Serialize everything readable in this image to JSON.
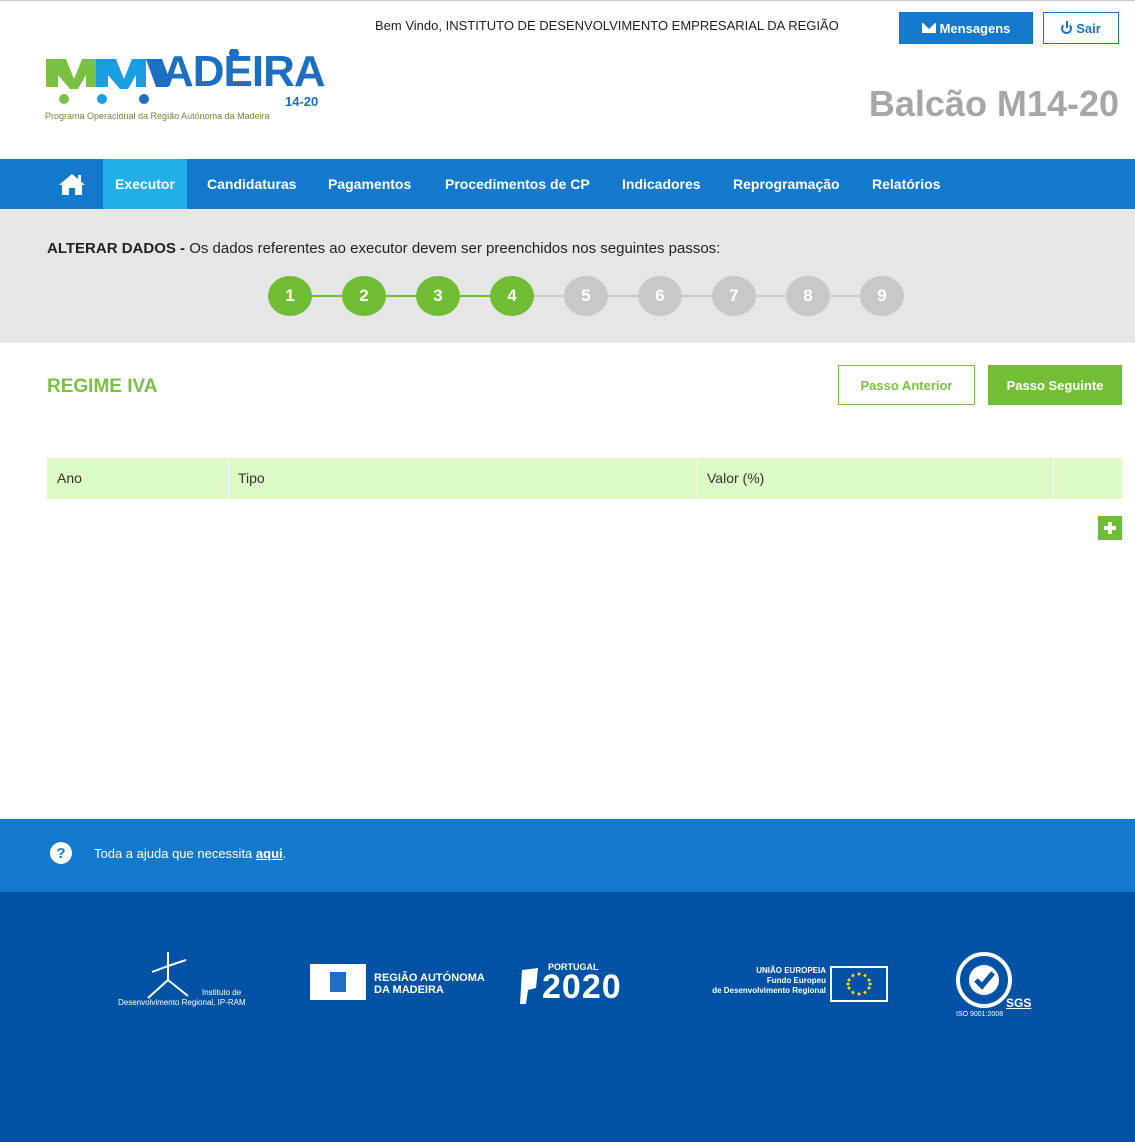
{
  "header": {
    "welcome": "Bem Vindo, INSTITUTO DE DESENVOLVIMENTO EMPRESARIAL DA REGIÃO",
    "messages_label": "Mensagens",
    "logout_label": "Sair",
    "logo_word": "ADEIRA",
    "logo_number": "14-20",
    "logo_subtitle": "Programa Operacional da Região Autónoma da Madeira",
    "portal_title": "Balcão M14-20"
  },
  "nav": {
    "items": [
      {
        "label": "Executor"
      },
      {
        "label": "Candidaturas"
      },
      {
        "label": "Pagamentos"
      },
      {
        "label": "Procedimentos de CP"
      },
      {
        "label": "Indicadores"
      },
      {
        "label": "Reprogramação"
      },
      {
        "label": "Relatórios"
      }
    ],
    "active_index": 0
  },
  "steps": {
    "title_bold": "ALTERAR DADOS -",
    "title_rest": " Os dados referentes ao executor devem ser preenchidos nos seguintes passos:",
    "items": [
      "1",
      "2",
      "3",
      "4",
      "5",
      "6",
      "7",
      "8",
      "9"
    ],
    "completed_count": 4
  },
  "section": {
    "title": "REGIME IVA",
    "prev_label": "Passo Anterior",
    "next_label": "Passo Seguinte"
  },
  "table": {
    "columns": [
      "Ano",
      "Tipo",
      "Valor (%)"
    ],
    "rows": []
  },
  "help": {
    "text": "Toda a ajuda que necessita ",
    "link": "aqui",
    "suffix": "."
  },
  "footer": {
    "logos": [
      {
        "name": "Instituto de Desenvolvimento Regional, IP-RAM",
        "line1": "Instituto de",
        "line2": "Desenvolvimento Regional, IP-RAM"
      },
      {
        "name": "Região Autónoma da Madeira",
        "line1": "REGIÃO AUTÓNOMA",
        "line2": "DA MADEIRA"
      },
      {
        "name": "Portugal 2020",
        "line1": "PORTUGAL",
        "line2": "2020"
      },
      {
        "name": "União Europeia",
        "line1": "UNIÃO EUROPEIA",
        "line2": "Fundo Europeu",
        "line3": "de Desenvolvimento Regional"
      },
      {
        "name": "SGS ISO 9001:2008",
        "line1": "SGS",
        "line2": "ISO 9001:2008"
      }
    ]
  },
  "colors": {
    "primary_blue": "#1279cc",
    "active_nav": "#22aee8",
    "green": "#7ac143",
    "footer_blue": "#0052a5",
    "table_header": "#dbfac4"
  }
}
